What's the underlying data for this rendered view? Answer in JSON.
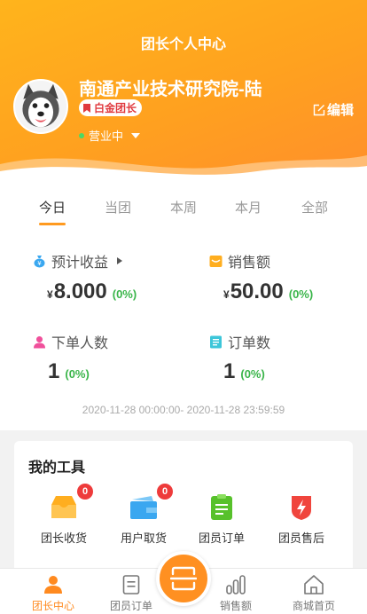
{
  "header": {
    "title": "团长个人中心",
    "name": "南通产业技术研究院-陆",
    "badge": "白金团长",
    "status": "营业中",
    "edit_label": "编辑"
  },
  "tabs": [
    {
      "label": "今日",
      "active": true
    },
    {
      "label": "当团",
      "active": false
    },
    {
      "label": "本周",
      "active": false
    },
    {
      "label": "本月",
      "active": false
    },
    {
      "label": "全部",
      "active": false
    }
  ],
  "metrics": {
    "income": {
      "label": "预计收益",
      "currency": "¥",
      "value": "8.000",
      "pct": "(0%)"
    },
    "sales": {
      "label": "销售额",
      "currency": "¥",
      "value": "50.00",
      "pct": "(0%)"
    },
    "buyers": {
      "label": "下单人数",
      "value": "1",
      "pct": "(0%)"
    },
    "orders": {
      "label": "订单数",
      "value": "1",
      "pct": "(0%)"
    }
  },
  "date_range": "2020-11-28 00:00:00- 2020-11-28 23:59:59",
  "tools": {
    "title": "我的工具",
    "items": [
      {
        "label": "团长收货",
        "badge": "0",
        "icon": "inbox-icon",
        "color": "#ffae1f"
      },
      {
        "label": "用户取货",
        "badge": "0",
        "icon": "wallet-icon",
        "color": "#3aa7f0"
      },
      {
        "label": "团员订单",
        "icon": "clipboard-icon",
        "color": "#57c12b"
      },
      {
        "label": "团员售后",
        "icon": "shield-bolt-icon",
        "color": "#f0453d"
      }
    ]
  },
  "nav": {
    "items": [
      {
        "label": "团长中心",
        "icon": "person-icon",
        "active": true
      },
      {
        "label": "团员订单",
        "icon": "document-icon",
        "active": false
      },
      {
        "label": "销售额",
        "icon": "bar-chart-icon",
        "active": false
      },
      {
        "label": "商城首页",
        "icon": "home-icon",
        "active": false
      }
    ],
    "center": {
      "icon": "scan-icon"
    }
  },
  "colors": {
    "accent": "#ff9a1f",
    "badge_red": "#e0393e",
    "positive": "#3ab54a"
  }
}
